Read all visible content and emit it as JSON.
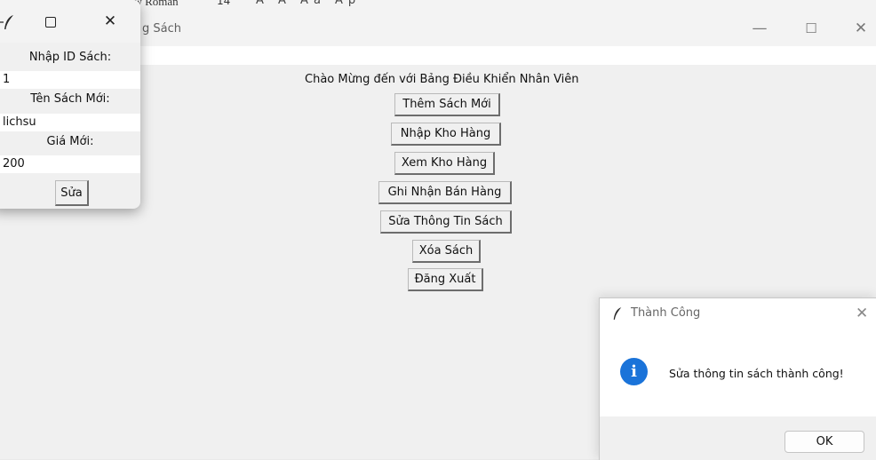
{
  "ribbon": {
    "font_name": "Times New Roman",
    "font_size": "14",
    "glyphs": "A A Aa Ap"
  },
  "main_window": {
    "title_fragment": "g Sách",
    "minimize": "—",
    "maximize": "☐",
    "close": "✕",
    "welcome": "Chào Mừng đến với Bảng Điều Khiển Nhân Viên",
    "buttons": {
      "add_book": "Thêm Sách Mới",
      "import_stock": "Nhập Kho Hàng",
      "view_stock": "Xem Kho Hàng",
      "record_sale": "Ghi Nhận Bán Hàng",
      "edit_book": "Sửa Thông Tin Sách",
      "delete_book": "Xóa Sách",
      "logout": "Đăng Xuất"
    }
  },
  "edit_window": {
    "close": "✕",
    "id_label": "Nhập ID Sách:",
    "id_value": "1",
    "name_label": "Tên Sách Mới:",
    "name_value": "lichsu",
    "price_label": "Giá Mới:",
    "price_value": "200",
    "submit": "Sửa"
  },
  "message_box": {
    "title": "Thành Công",
    "close": "✕",
    "message": "Sửa thông tin sách thành công!",
    "ok": "OK",
    "icon": "i"
  }
}
